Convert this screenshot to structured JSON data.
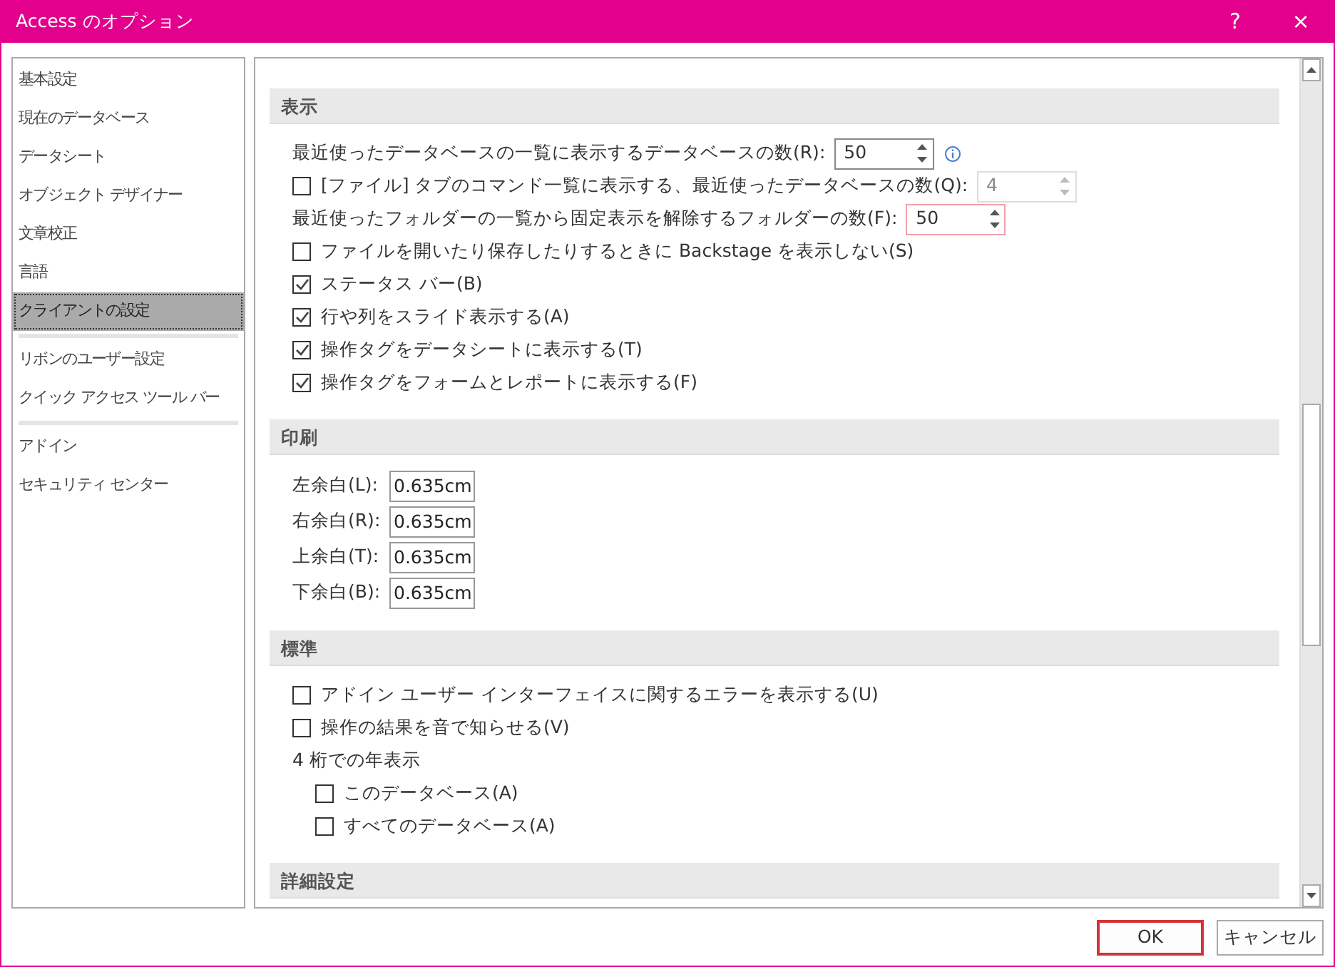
{
  "window": {
    "title": "Access のオプション",
    "help": "?",
    "close": "×"
  },
  "sidebar": {
    "items": [
      {
        "label": "基本設定",
        "selected": false,
        "divider_after": false
      },
      {
        "label": "現在のデータベース",
        "selected": false,
        "divider_after": false
      },
      {
        "label": "データシート",
        "selected": false,
        "divider_after": false
      },
      {
        "label": "オブジェクト デザイナー",
        "selected": false,
        "divider_after": false
      },
      {
        "label": "文章校正",
        "selected": false,
        "divider_after": false
      },
      {
        "label": "言語",
        "selected": false,
        "divider_after": false
      },
      {
        "label": "クライアントの設定",
        "selected": true,
        "divider_after": true
      },
      {
        "label": "リボンのユーザー設定",
        "selected": false,
        "divider_after": false
      },
      {
        "label": "クイック アクセス ツール バー",
        "selected": false,
        "divider_after": true
      },
      {
        "label": "アドイン",
        "selected": false,
        "divider_after": false
      },
      {
        "label": "セキュリティ センター",
        "selected": false,
        "divider_after": false
      }
    ]
  },
  "sections": [
    {
      "title": "表示",
      "items": [
        {
          "kind": "spin",
          "label": "最近使ったデータベースの一覧に表示するデータベースの数(R):",
          "value": "50",
          "info": true,
          "focused": false,
          "disabled": false
        },
        {
          "kind": "check_spin",
          "checked": false,
          "label": "[ファイル] タブのコマンド一覧に表示する、最近使ったデータベースの数(Q):",
          "value": "4",
          "disabled": true,
          "focused": false
        },
        {
          "kind": "spin",
          "label": "最近使ったフォルダーの一覧から固定表示を解除するフォルダーの数(F):",
          "value": "50",
          "focused": true,
          "disabled": false
        },
        {
          "kind": "check",
          "label": "ファイルを開いたり保存したりするときに Backstage を表示しない(S)",
          "checked": false
        },
        {
          "kind": "check",
          "label": "ステータス バー(B)",
          "checked": true
        },
        {
          "kind": "check",
          "label": "行や列をスライド表示する(A)",
          "checked": true
        },
        {
          "kind": "check",
          "label": "操作タグをデータシートに表示する(T)",
          "checked": true
        },
        {
          "kind": "check",
          "label": "操作タグをフォームとレポートに表示する(F)",
          "checked": true
        }
      ]
    },
    {
      "title": "印刷",
      "items": [
        {
          "kind": "field",
          "label": "左余白(L):",
          "value": "0.635cm"
        },
        {
          "kind": "field",
          "label": "右余白(R):",
          "value": "0.635cm"
        },
        {
          "kind": "field",
          "label": "上余白(T):",
          "value": "0.635cm"
        },
        {
          "kind": "field",
          "label": "下余白(B):",
          "value": "0.635cm"
        }
      ]
    },
    {
      "title": "標準",
      "items": [
        {
          "kind": "check",
          "label": "アドイン ユーザー インターフェイスに関するエラーを表示する(U)",
          "checked": false
        },
        {
          "kind": "check",
          "label": "操作の結果を音で知らせる(V)",
          "checked": false
        },
        {
          "kind": "group",
          "label": "4 桁での年表示",
          "children": [
            {
              "kind": "check",
              "label": "このデータベース(A)",
              "checked": false
            },
            {
              "kind": "check",
              "label": "すべてのデータベース(A)",
              "checked": false
            }
          ]
        }
      ]
    },
    {
      "title": "詳細設定"
    }
  ],
  "buttons": [
    {
      "label": "OK",
      "default": true
    },
    {
      "label": "キャンセル",
      "default": false
    }
  ]
}
